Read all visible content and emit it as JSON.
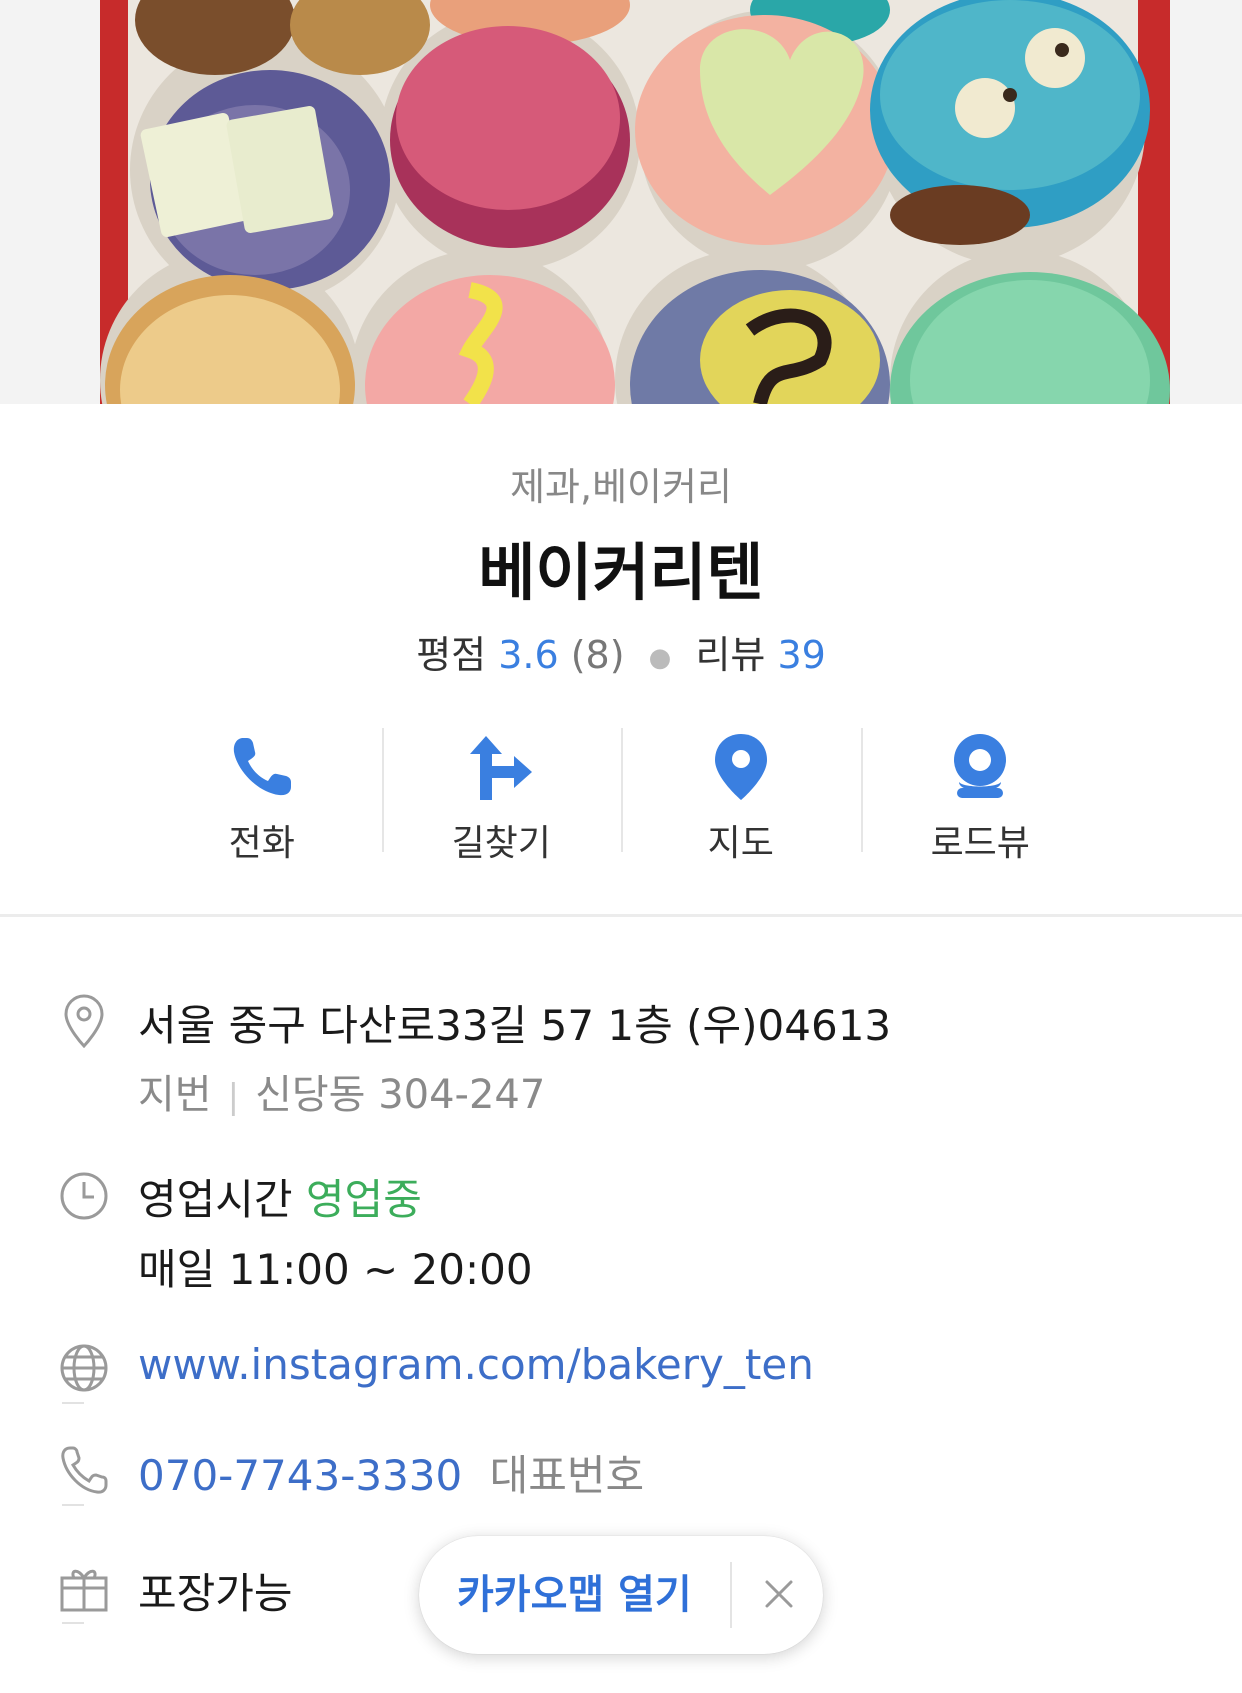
{
  "hero": {
    "image_alt": "macarons-photo"
  },
  "header": {
    "category": "제과,베이커리",
    "name": "베이커리텐"
  },
  "rating": {
    "label": "평점",
    "score": "3.6",
    "count": "(8)",
    "review_label": "리뷰",
    "review_count": "39"
  },
  "actions": [
    {
      "label": "전화",
      "icon": "phone-icon"
    },
    {
      "label": "길찾기",
      "icon": "directions-icon"
    },
    {
      "label": "지도",
      "icon": "map-pin-icon"
    },
    {
      "label": "로드뷰",
      "icon": "roadview-icon"
    }
  ],
  "info": {
    "address": "서울 중구 다산로33길 57 1층 (우)04613",
    "lot_label": "지번",
    "lot_address": "신당동 304-247",
    "hours_label": "영업시간",
    "hours_status": "영업중",
    "hours_detail": "매일 11:00 ~ 20:00",
    "website": "www.instagram.com/bakery_ten",
    "phone": "070-7743-3330",
    "phone_note": "대표번호",
    "takeout": "포장가능"
  },
  "pill": {
    "open_label": "카카오맵 열기"
  },
  "colors": {
    "accent_blue": "#3a7fe0",
    "status_green": "#3cad5b",
    "link_blue": "#3d6ec8"
  }
}
